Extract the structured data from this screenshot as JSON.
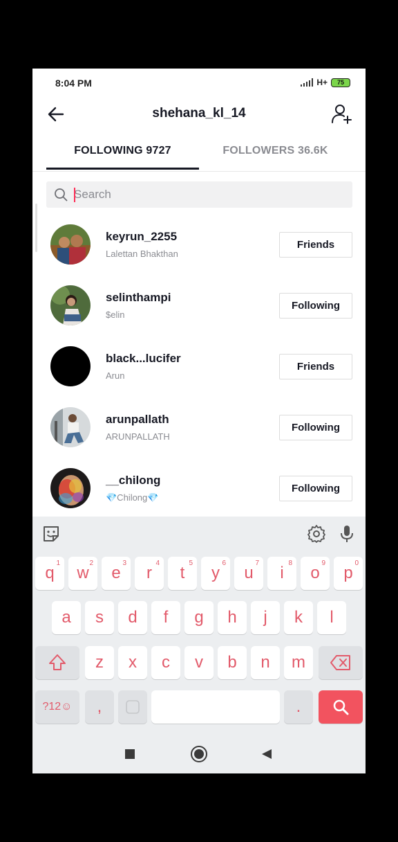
{
  "status_bar": {
    "time": "8:04 PM",
    "network": "H+",
    "battery": "75"
  },
  "header": {
    "title": "shehana_kl_14"
  },
  "tabs": [
    {
      "label": "FOLLOWING 9727",
      "active": true
    },
    {
      "label": "FOLLOWERS 36.6K",
      "active": false
    }
  ],
  "search": {
    "placeholder": "Search",
    "value": ""
  },
  "users": [
    {
      "username": "keyrun_2255",
      "nickname": "Lalettan Bhakthan",
      "button": "Friends",
      "avatar_color": "#8a6a3a"
    },
    {
      "username": "selinthampi",
      "nickname": "$elin",
      "button": "Following",
      "avatar_color": "#4f6b3c"
    },
    {
      "username": "black...lucifer",
      "nickname": "Arun",
      "button": "Friends",
      "avatar_color": "#000000"
    },
    {
      "username": "arunpallath",
      "nickname": "ARUNPALLATH",
      "button": "Following",
      "avatar_color": "#9aa3a8"
    },
    {
      "username": "__chilong",
      "nickname": "💎Chilong💎",
      "button": "Following",
      "avatar_color": "#b2453a"
    }
  ],
  "keyboard": {
    "row1": [
      {
        "key": "q",
        "num": "1"
      },
      {
        "key": "w",
        "num": "2"
      },
      {
        "key": "e",
        "num": "3"
      },
      {
        "key": "r",
        "num": "4"
      },
      {
        "key": "t",
        "num": "5"
      },
      {
        "key": "y",
        "num": "6"
      },
      {
        "key": "u",
        "num": "7"
      },
      {
        "key": "i",
        "num": "8"
      },
      {
        "key": "o",
        "num": "9"
      },
      {
        "key": "p",
        "num": "0"
      }
    ],
    "row2": [
      "a",
      "s",
      "d",
      "f",
      "g",
      "h",
      "j",
      "k",
      "l"
    ],
    "row3": [
      "z",
      "x",
      "c",
      "v",
      "b",
      "n",
      "m"
    ],
    "symbols_key": "?12☺",
    "comma_key": ",",
    "period_key": "."
  },
  "colors": {
    "accent": "#fe2c55",
    "key_text": "#e25a6a",
    "search_key": "#f2535f"
  }
}
